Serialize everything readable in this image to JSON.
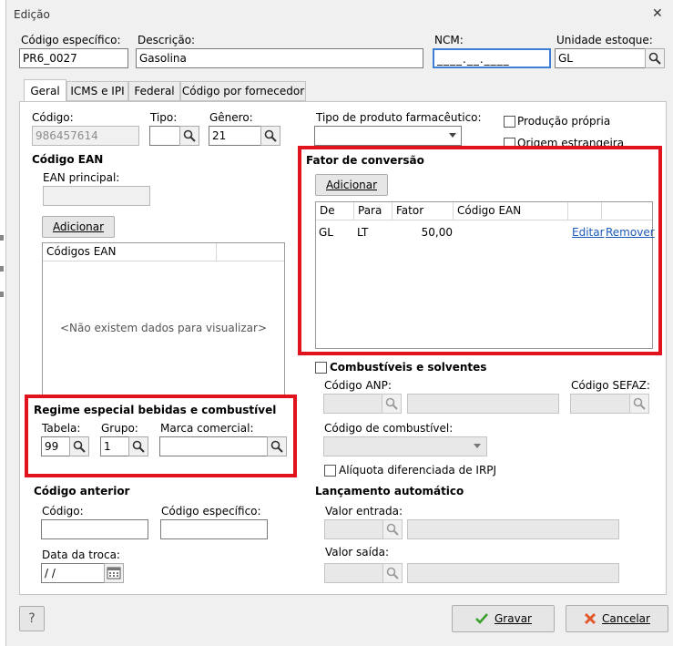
{
  "window": {
    "title": "Edição",
    "close_glyph": "✕"
  },
  "header": {
    "codigo_especifico": {
      "label": "Código específico:",
      "value": "PR6_0027"
    },
    "descricao": {
      "label": "Descrição:",
      "value": "Gasolina"
    },
    "ncm": {
      "label": "NCM:",
      "value": "____.__.____"
    },
    "unidade_estoque": {
      "label": "Unidade estoque:",
      "value": "GL"
    }
  },
  "tabs": [
    {
      "label": "Geral"
    },
    {
      "label": "ICMS e IPI"
    },
    {
      "label": "Federal"
    },
    {
      "label": "Código por fornecedor"
    }
  ],
  "geral": {
    "codigo": {
      "label": "Código:",
      "value": "986457614"
    },
    "tipo": {
      "label": "Tipo:",
      "value": ""
    },
    "genero": {
      "label": "Gênero:",
      "value": "21"
    },
    "tipo_farmaceutico": {
      "label": "Tipo de produto farmacêutico:",
      "value": ""
    },
    "producao_propria": "Produção própria",
    "origem_estrangeira": "Origem estrangeira"
  },
  "codigo_ean": {
    "section_title": "Código EAN",
    "ean_principal_label": "EAN principal:",
    "ean_principal_value": "",
    "add_button": "Adicionar",
    "grid_header": "Códigos EAN",
    "empty_text": "<Não existem dados para visualizar>"
  },
  "fator_conversao": {
    "section_title": "Fator de conversão",
    "add_button": "Adicionar",
    "columns": [
      "De",
      "Para",
      "Fator",
      "Código EAN"
    ],
    "rows": [
      {
        "de": "GL",
        "para": "LT",
        "fator": "50,00",
        "codigo_ean": "",
        "edit": "Editar",
        "remove": "Remover"
      }
    ]
  },
  "combustiveis": {
    "section_title": "Combustíveis e solventes",
    "codigo_anp_label": "Código ANP:",
    "codigo_sefaz_label": "Código SEFAZ:",
    "codigo_combustivel_label": "Código de combustível:",
    "aliquota_label": "Alíquota diferenciada de IRPJ"
  },
  "regime_especial": {
    "section_title": "Regime especial bebidas e combustível",
    "tabela": {
      "label": "Tabela:",
      "value": "99"
    },
    "grupo": {
      "label": "Grupo:",
      "value": "1"
    },
    "marca": {
      "label": "Marca comercial:",
      "value": ""
    }
  },
  "codigo_anterior": {
    "section_title": "Código anterior",
    "codigo_label": "Código:",
    "codigo_especifico_label": "Código específico:",
    "data_troca_label": "Data da troca:",
    "data_troca_value": " /  /"
  },
  "lancamento": {
    "section_title": "Lançamento automático",
    "valor_entrada_label": "Valor entrada:",
    "valor_saida_label": "Valor saída:"
  },
  "footer": {
    "help_label": "?",
    "save_label": "Gravar",
    "cancel_label": "Cancelar"
  },
  "colors": {
    "highlight": "#e0121d",
    "link": "#1c5ab8"
  }
}
